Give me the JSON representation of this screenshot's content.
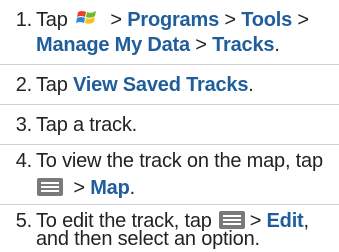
{
  "steps": [
    {
      "num": "1.",
      "pre": "Tap",
      "sep1": ">",
      "b1": "Programs",
      "sep2": ">",
      "b2": "Tools",
      "sep3": ">",
      "b3": "Manage My Data",
      "sep4": ">",
      "b4": "Tracks",
      "end": "."
    },
    {
      "num": "2.",
      "pre": "Tap ",
      "b1": "View Saved Tracks",
      "end": "."
    },
    {
      "num": "3.",
      "text": "Tap a track."
    },
    {
      "num": "4.",
      "line1": "To view the track on the map, tap",
      "sep1": ">",
      "b1": "Map",
      "end": "."
    },
    {
      "num": "5.",
      "pre": "To edit the track, tap",
      "sep1": ">",
      "b1": "Edit",
      "mid": ",",
      "line2": "and then select an option."
    }
  ],
  "icons": {
    "start": "windows-start-icon",
    "menu": "menu-icon"
  },
  "colors": {
    "accent": "#1f5e9b",
    "text": "#222222",
    "divider": "#cfcfcf"
  }
}
